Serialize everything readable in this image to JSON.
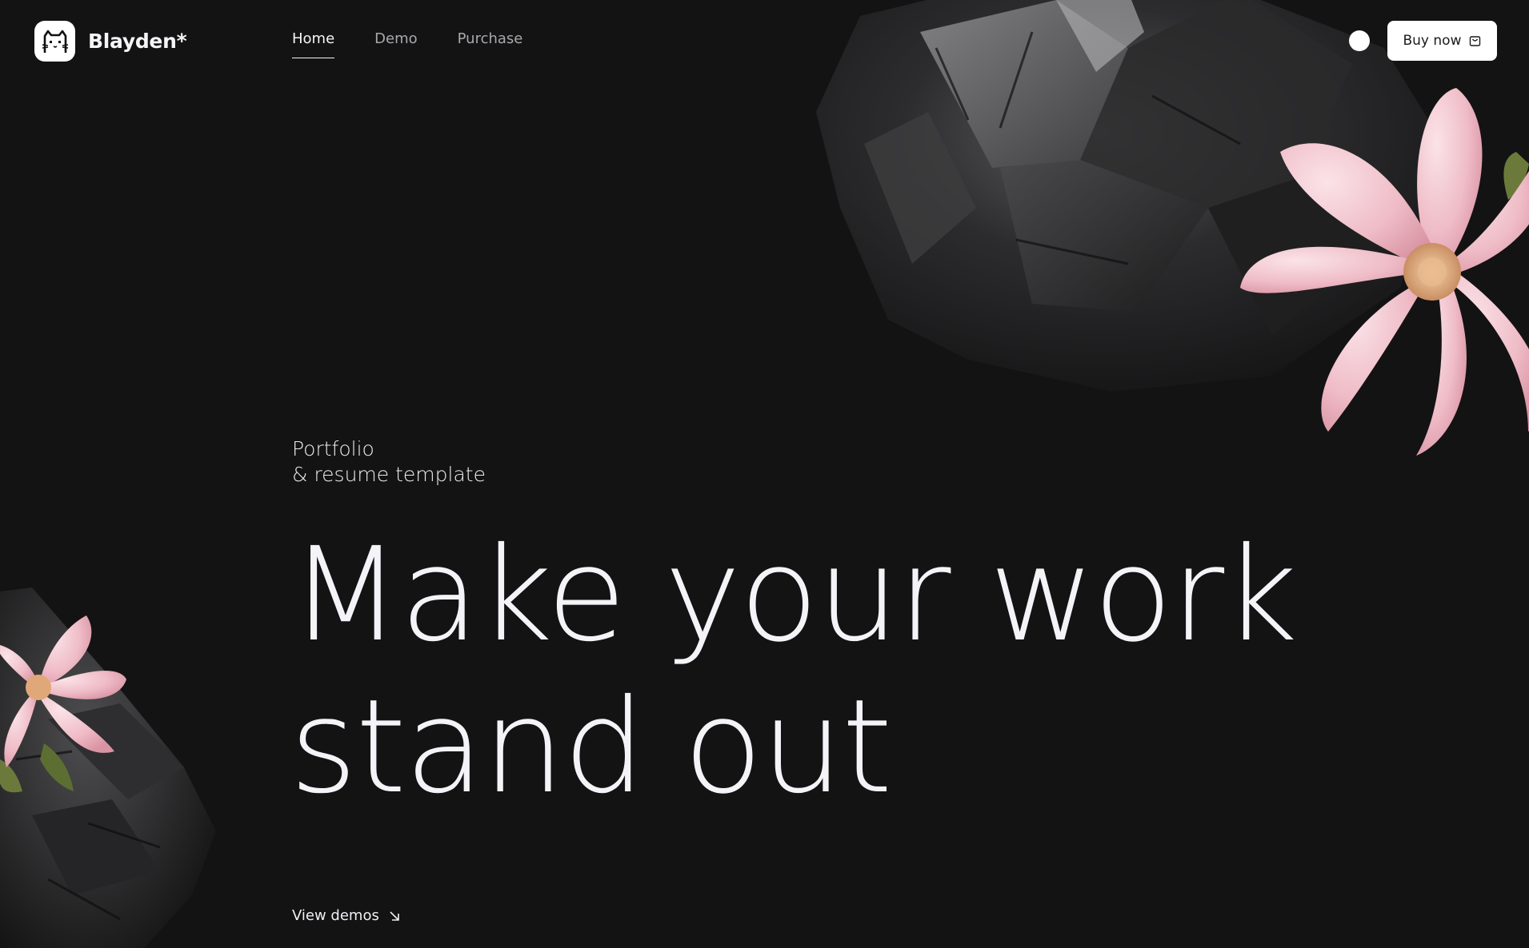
{
  "brand": {
    "name": "Blayden*",
    "logo_icon": "cat-icon"
  },
  "nav": {
    "items": [
      {
        "label": "Home",
        "active": true
      },
      {
        "label": "Demo",
        "active": false
      },
      {
        "label": "Purchase",
        "active": false
      }
    ]
  },
  "header_actions": {
    "theme_toggle_icon": "circle-toggle-icon",
    "buy_label": "Buy now",
    "buy_icon": "cart-icon"
  },
  "hero": {
    "subtitle_line1": "Portfolio",
    "subtitle_line2": "& resume template",
    "title_line1": "Make your work",
    "title_line2": "stand out",
    "cta_label": "View demos",
    "cta_icon": "arrow-down-right-icon"
  },
  "colors": {
    "background": "#131314",
    "text": "#f4f3f7",
    "muted_text": "#a9a8ad",
    "button_bg": "#ffffff",
    "flower_pink": "#f1c6cf"
  }
}
